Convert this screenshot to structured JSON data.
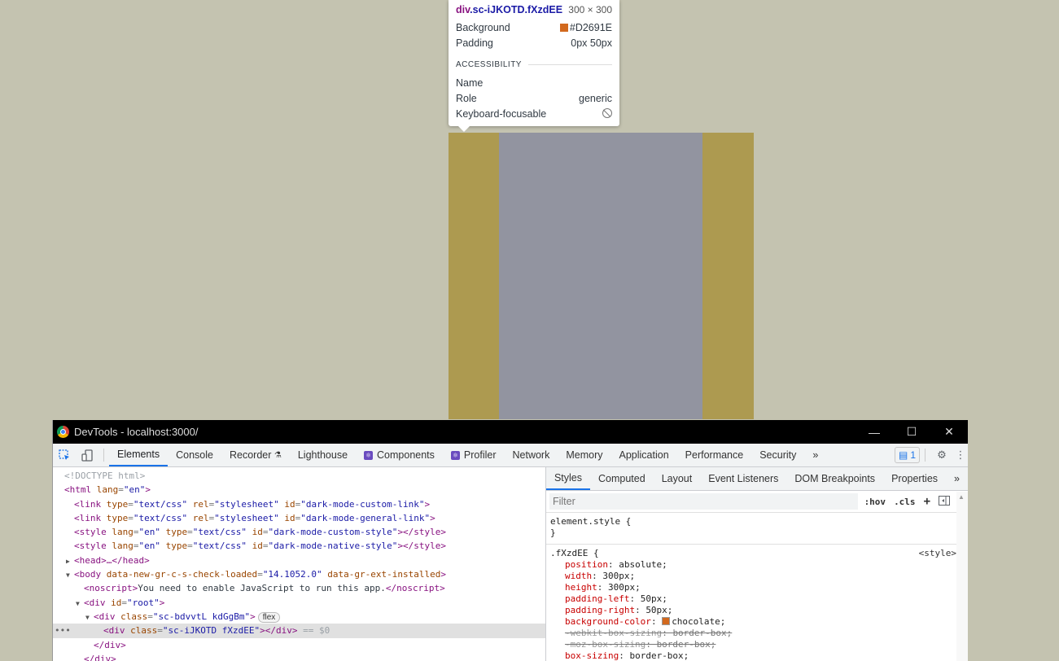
{
  "tooltip": {
    "tag": "div",
    "classes": ".sc-iJKOTD.fXzdEE",
    "size": "300 × 300",
    "rows": [
      {
        "label": "Background",
        "value": "#D2691E"
      },
      {
        "label": "Padding",
        "value": "0px 50px"
      }
    ],
    "accessibility_header": "ACCESSIBILITY",
    "a11y": {
      "name_label": "Name",
      "role_label": "Role",
      "role_value": "generic",
      "focusable_label": "Keyboard-focusable"
    }
  },
  "window": {
    "title": "DevTools - localhost:3000/",
    "minimize": "—",
    "maximize": "☐",
    "close": "✕"
  },
  "main_tabs": {
    "elements": "Elements",
    "console": "Console",
    "recorder": "Recorder",
    "lighthouse": "Lighthouse",
    "components": "Components",
    "profiler": "Profiler",
    "network": "Network",
    "memory": "Memory",
    "application": "Application",
    "performance": "Performance",
    "security": "Security",
    "more": "»",
    "message_count": "1"
  },
  "dom": {
    "doctype": "<!DOCTYPE html>",
    "html_open_tag": "<html",
    "html_lang_attr": "lang",
    "html_lang_val": "\"en\"",
    "link1_type": "\"text/css\"",
    "link1_rel": "\"stylesheet\"",
    "link1_id": "\"dark-mode-custom-link\"",
    "link2_id": "\"dark-mode-general-link\"",
    "style1_id": "\"dark-mode-custom-style\"",
    "style2_id": "\"dark-mode-native-style\"",
    "head": "<head>…</head>",
    "body_attr": "data-new-gr-c-s-check-loaded",
    "body_attr_val": "\"14.1052.0\"",
    "body_attr2": "data-gr-ext-installed",
    "noscript_text": "You need to enable JavaScript to run this app.",
    "root_id": "\"root\"",
    "flex_class": "\"sc-bdvvtL kdGgBm\"",
    "flex_pill": "flex",
    "selected_class": "\"sc-iJKOTD fXzdEE\"",
    "selected_suffix": "== $0"
  },
  "style_tabs": {
    "styles": "Styles",
    "computed": "Computed",
    "layout": "Layout",
    "event_listeners": "Event Listeners",
    "dom_breakpoints": "DOM Breakpoints",
    "properties": "Properties",
    "more": "»"
  },
  "filter": {
    "placeholder": "Filter",
    "hov": ":hov",
    "cls": ".cls",
    "plus": "+"
  },
  "rules": {
    "element_style": "element.style {",
    "close_brace": "}",
    "selector": ".fXzdEE {",
    "source": "<style>",
    "decls": [
      {
        "prop": "position",
        "value": "absolute;"
      },
      {
        "prop": "width",
        "value": "300px;"
      },
      {
        "prop": "height",
        "value": "300px;"
      },
      {
        "prop": "padding-left",
        "value": "50px;"
      },
      {
        "prop": "padding-right",
        "value": "50px;"
      },
      {
        "prop": "background-color",
        "value": "chocolate;"
      },
      {
        "prop": "-webkit-box-sizing",
        "value": "border-box;"
      },
      {
        "prop": "-moz-box-sizing",
        "value": "border-box;"
      },
      {
        "prop": "box-sizing",
        "value": "border-box;"
      }
    ]
  },
  "colors": {
    "background_swatch": "#D2691E",
    "accent": "#1a73e8"
  }
}
